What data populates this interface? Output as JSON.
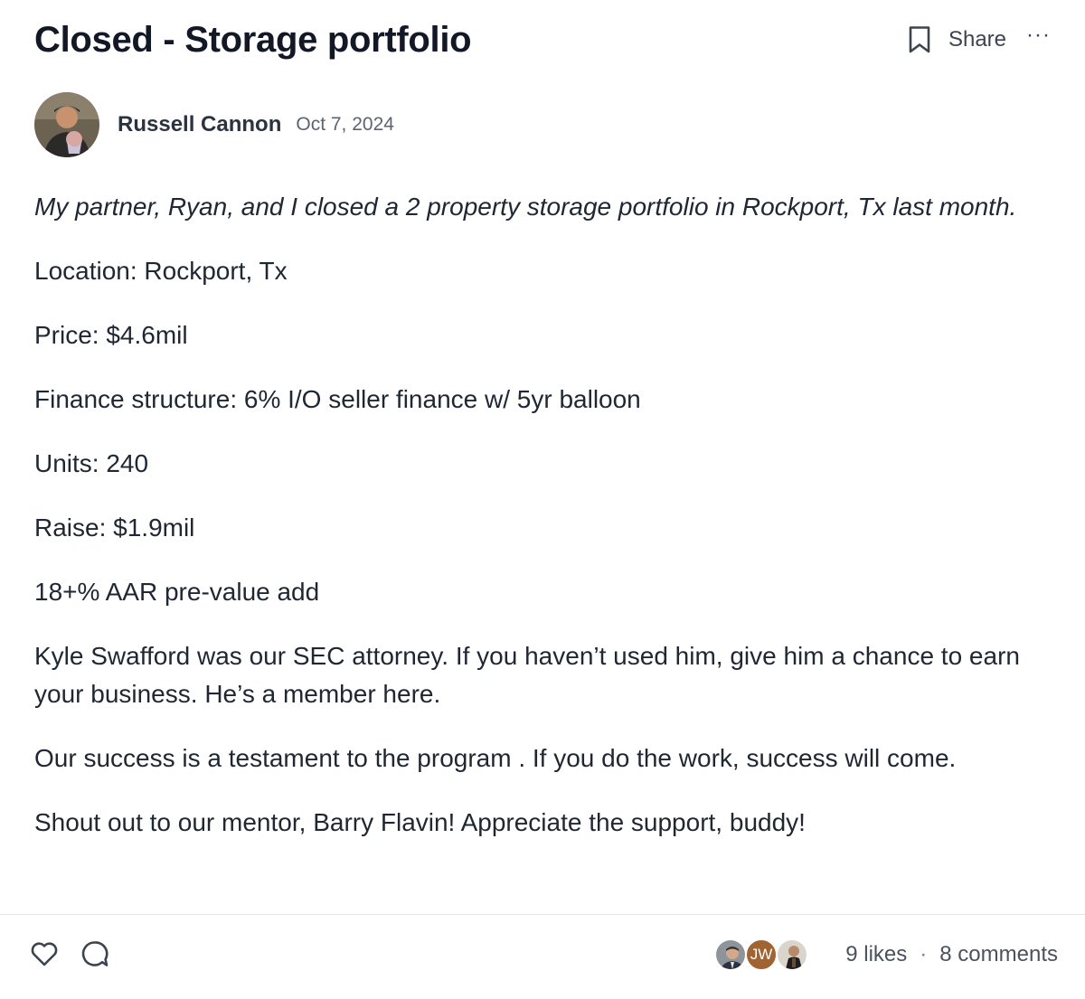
{
  "post": {
    "title": "Closed - Storage portfolio",
    "share_label": "Share",
    "more_label": "···",
    "author": "Russell Cannon",
    "date": "Oct 7, 2024",
    "body": [
      "My partner, Ryan, and I closed a 2 property storage portfolio in Rockport, Tx last month.",
      "Location:  Rockport, Tx",
      "Price:  $4.6mil",
      "Finance structure: 6% I/O seller finance w/ 5yr balloon",
      "Units:  240",
      "Raise:  $1.9mil",
      "18+% AAR pre-value add",
      "Kyle Swafford was our SEC attorney.  If you haven’t used him, give him a chance to earn your business.  He’s a member here.",
      "Our success is a testament to the program . If you do the work, success will come.",
      "Shout out to our mentor, Barry Flavin!  Appreciate the support, buddy!"
    ]
  },
  "footer": {
    "likes": "9 likes",
    "separator": "·",
    "comments": "8 comments",
    "likers": [
      {
        "icon": "photo-avatar"
      },
      {
        "initials": "JW",
        "color": "#a06432"
      },
      {
        "icon": "photo-avatar"
      }
    ]
  },
  "icons": {
    "bookmark": "bookmark-icon",
    "heart": "heart-icon",
    "comment": "comment-bubble-icon"
  }
}
